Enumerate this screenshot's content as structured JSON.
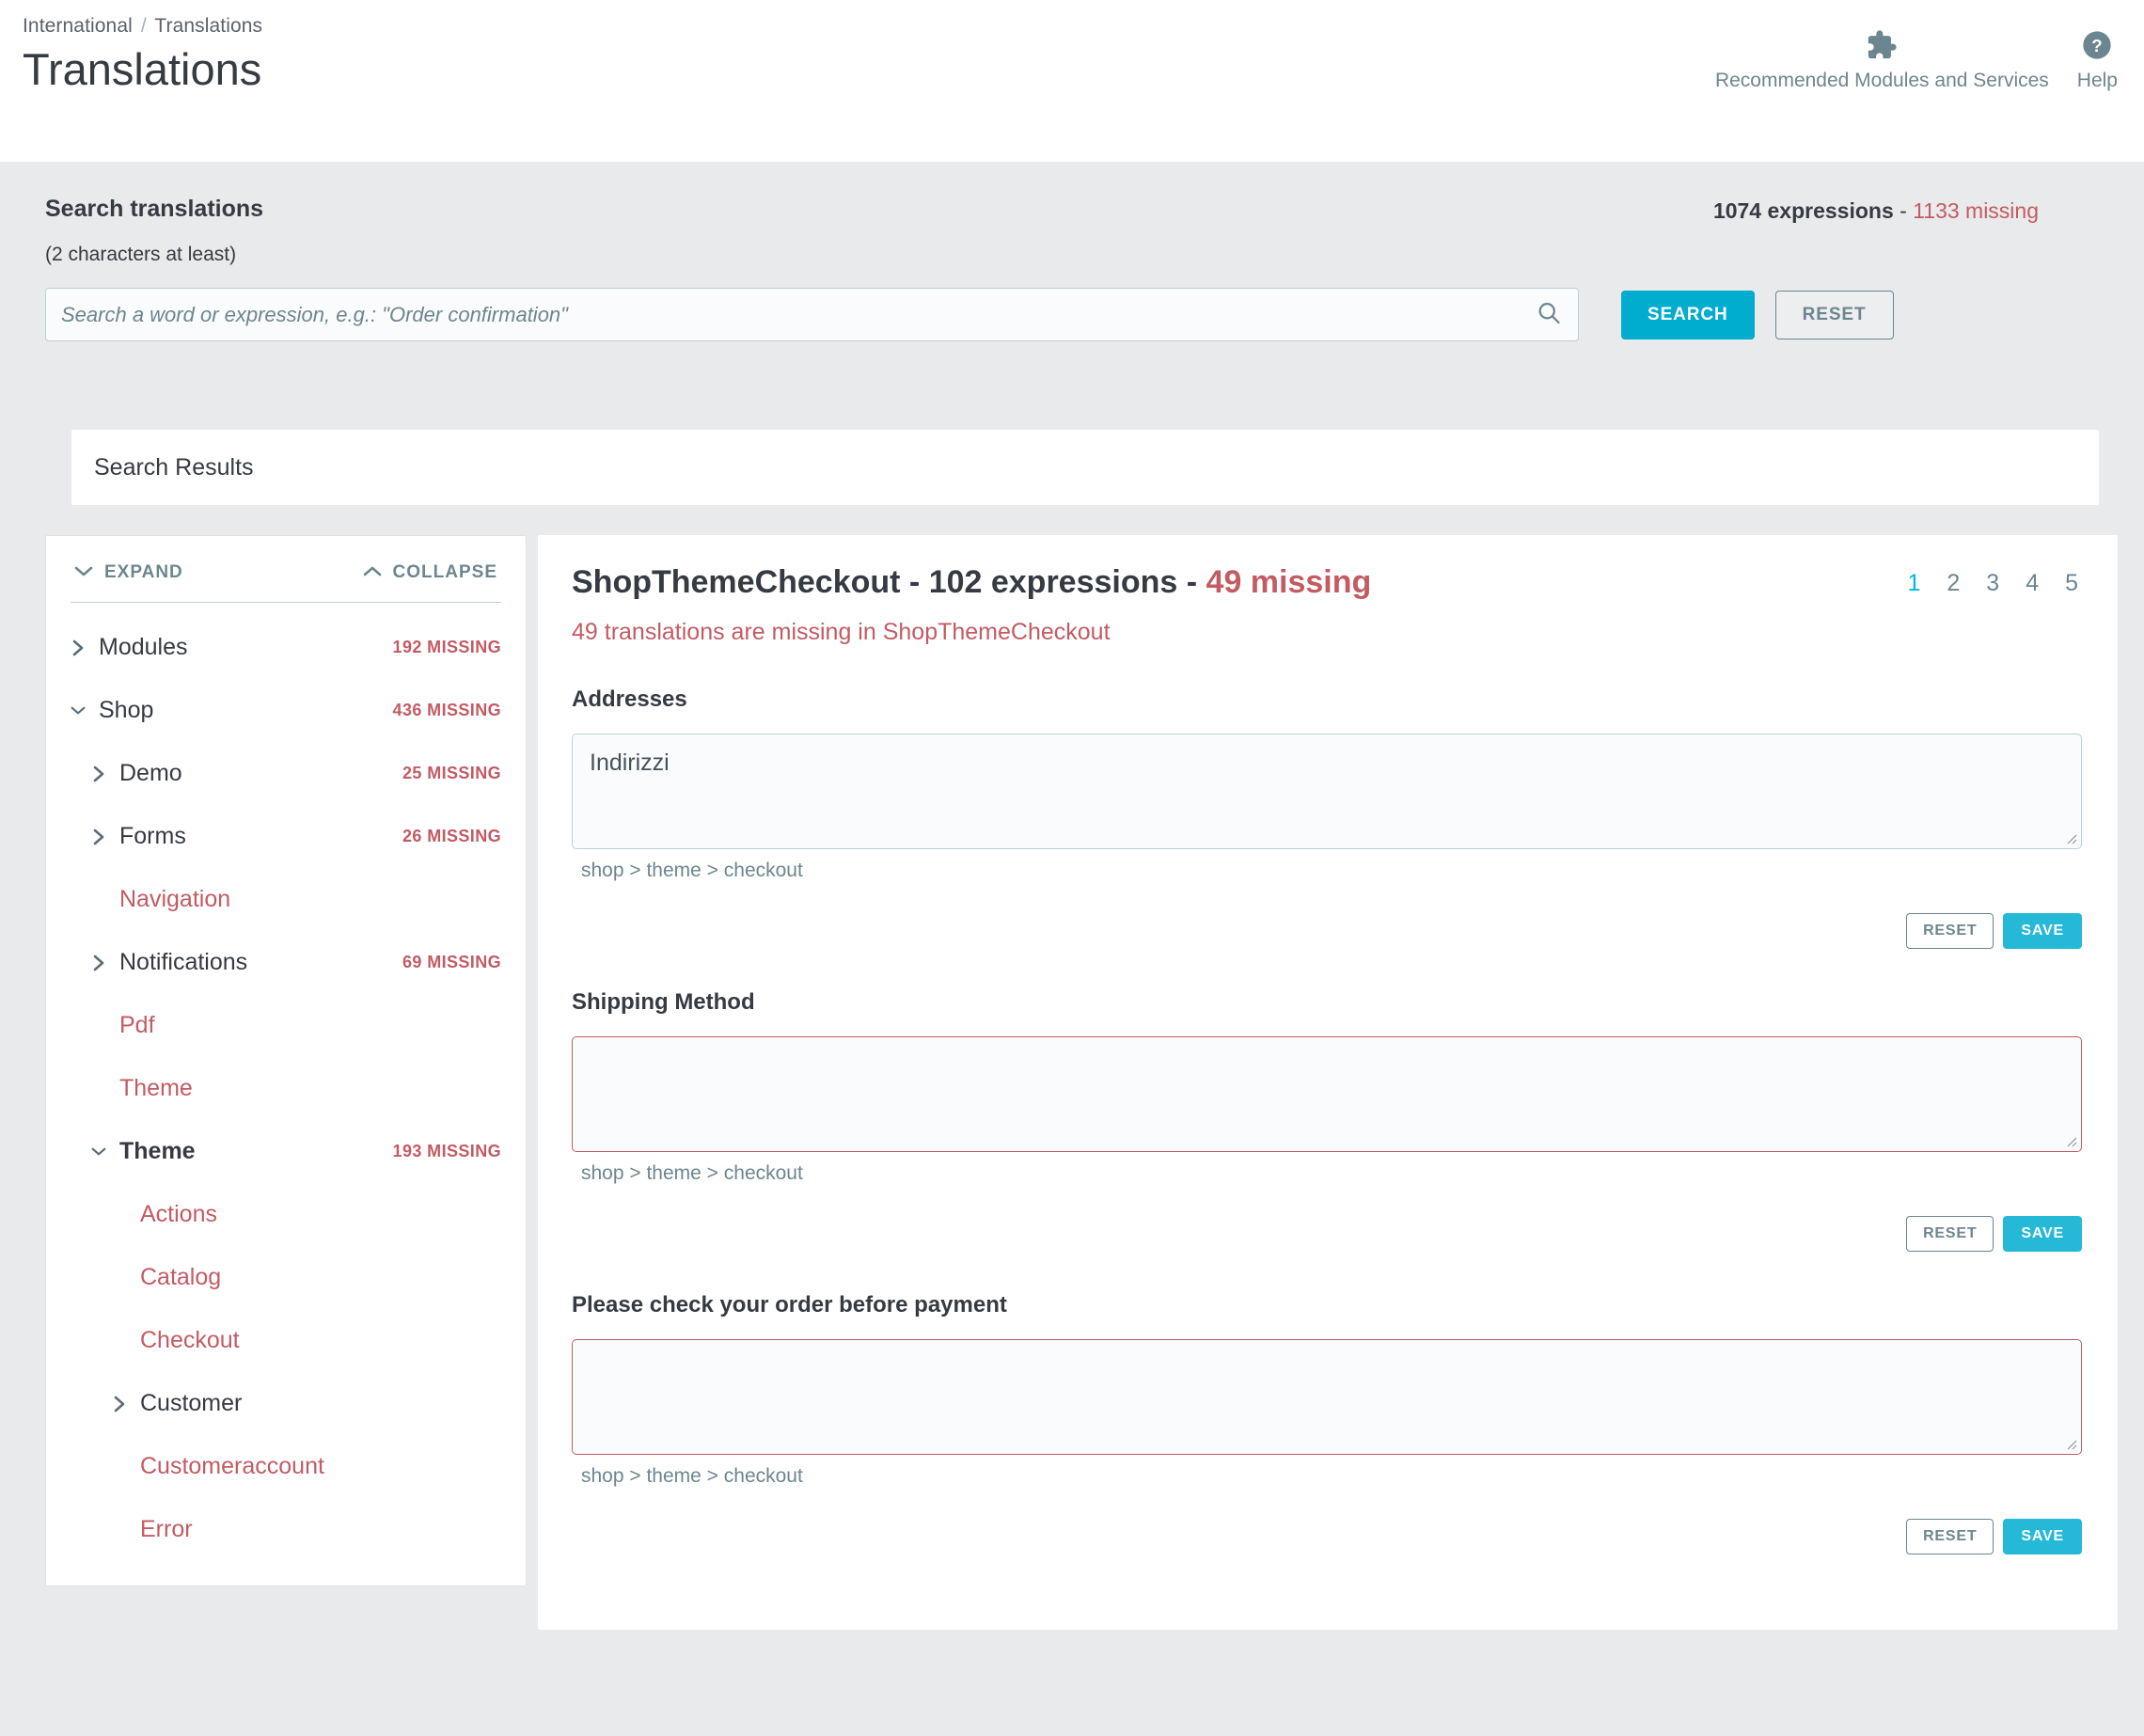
{
  "header": {
    "breadcrumb_parent": "International",
    "breadcrumb_sep": "/",
    "breadcrumb_current": "Translations",
    "title": "Translations",
    "tools": [
      {
        "icon": "puzzle-piece-icon",
        "label": "Recommended Modules and Services"
      },
      {
        "icon": "help-circle-icon",
        "label": "Help"
      }
    ]
  },
  "search": {
    "label": "Search translations",
    "hint": "(2 characters at least)",
    "placeholder": "Search a word or expression, e.g.: \"Order confirmation\"",
    "value": "",
    "search_button": "SEARCH",
    "reset_button": "RESET",
    "count_expressions": "1074 expressions",
    "count_dash": " - ",
    "count_missing": "1133 missing"
  },
  "results_card": {
    "title": "Search Results"
  },
  "tree": {
    "expand_label": "EXPAND",
    "collapse_label": "COLLAPSE",
    "items": [
      {
        "label": "Modules",
        "missing": "192 MISSING",
        "indent": 0,
        "chevron": "right",
        "style": "normal"
      },
      {
        "label": "Shop",
        "missing": "436 MISSING",
        "indent": 0,
        "chevron": "down",
        "style": "normal"
      },
      {
        "label": "Demo",
        "missing": "25 MISSING",
        "indent": 1,
        "chevron": "right",
        "style": "normal"
      },
      {
        "label": "Forms",
        "missing": "26 MISSING",
        "indent": 1,
        "chevron": "right",
        "style": "normal"
      },
      {
        "label": "Navigation",
        "missing": "",
        "indent": 1,
        "chevron": "none",
        "style": "leaf"
      },
      {
        "label": "Notifications",
        "missing": "69 MISSING",
        "indent": 1,
        "chevron": "right",
        "style": "normal"
      },
      {
        "label": "Pdf",
        "missing": "",
        "indent": 1,
        "chevron": "none",
        "style": "leaf"
      },
      {
        "label": "Theme",
        "missing": "",
        "indent": 1,
        "chevron": "none",
        "style": "leaf"
      },
      {
        "label": "Theme",
        "missing": "193 MISSING",
        "indent": 1,
        "chevron": "down",
        "style": "bold"
      },
      {
        "label": "Actions",
        "missing": "",
        "indent": 2,
        "chevron": "none",
        "style": "leaf"
      },
      {
        "label": "Catalog",
        "missing": "",
        "indent": 2,
        "chevron": "none",
        "style": "leaf"
      },
      {
        "label": "Checkout",
        "missing": "",
        "indent": 2,
        "chevron": "none",
        "style": "leaf"
      },
      {
        "label": "Customer",
        "missing": "",
        "indent": 2,
        "chevron": "right",
        "style": "normal"
      },
      {
        "label": "Customeraccount",
        "missing": "",
        "indent": 2,
        "chevron": "none",
        "style": "leaf"
      },
      {
        "label": "Error",
        "missing": "",
        "indent": 2,
        "chevron": "none",
        "style": "leaf"
      }
    ]
  },
  "main": {
    "title_main": "ShopThemeCheckout - 102 expressions - ",
    "title_missing": "49 missing",
    "subtitle": "49 translations are missing in ShopThemeCheckout",
    "pagination": [
      "1",
      "2",
      "3",
      "4",
      "5"
    ],
    "active_page": "1",
    "reset_label": "RESET",
    "save_label": "SAVE",
    "fields": [
      {
        "label": "Addresses",
        "value": "Indirizzi",
        "path": "shop > theme > checkout",
        "missing": false
      },
      {
        "label": "Shipping Method",
        "value": "",
        "path": "shop > theme > checkout",
        "missing": true
      },
      {
        "label": "Please check your order before payment",
        "value": "",
        "path": "shop > theme > checkout",
        "missing": true
      }
    ]
  },
  "colors": {
    "accent_cyan": "#00adce",
    "missing_red": "#c35b63",
    "text_dark": "#363a41",
    "muted": "#6c868f"
  }
}
